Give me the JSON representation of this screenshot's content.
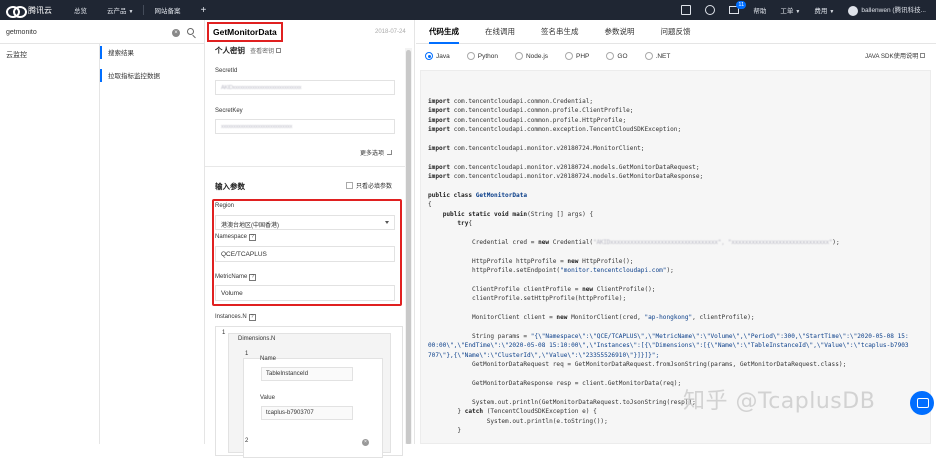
{
  "topbar": {
    "brand": "腾讯云",
    "nav": [
      "总览",
      "云产品",
      "网站备案"
    ],
    "mail_badge": "11",
    "right_items": [
      "帮助",
      "工单",
      "费用"
    ],
    "user": "ballenwen (腾讯科技..."
  },
  "search": {
    "value": "getmonito",
    "placeholder": ""
  },
  "categories": [
    "云监控"
  ],
  "results": {
    "header": "搜索结果",
    "item": "拉取指标监控数据"
  },
  "api": {
    "name": "GetMonitorData",
    "date": "2018-07-24",
    "personal_key_title": "个人密钥",
    "view_key_link": "查看密钥",
    "secret_id_label": "SecretId",
    "secret_id_value": "AKIDxxxxxxxxxxxxxxxxxxxxxxxxxxxx",
    "secret_key_label": "SecretKey",
    "secret_key_value": "xxxxxxxxxxxxxxxxxxxxxxxxxxxxx",
    "more_options": "更多选项",
    "input_params_title": "输入参数",
    "required_only": "只看必填参数",
    "region_label": "Region",
    "region_value": "港澳台地区(中国香港)",
    "namespace_label": "Namespace",
    "namespace_value": "QCE/TCAPLUS",
    "metric_label": "MetricName",
    "metric_value": "Volume",
    "instances_label": "Instances.N",
    "inst_index": "1",
    "dimensions_label": "Dimensions.N",
    "dim_index_1": "1",
    "dim_index_2": "2",
    "name_label": "Name",
    "name_value": "TableInstanceId",
    "value_label": "Value",
    "value_value": "tcaplus-b7903707"
  },
  "tabs": [
    "代码生成",
    "在线调用",
    "签名串生成",
    "参数说明",
    "问题反馈"
  ],
  "languages": [
    {
      "name": "Java",
      "selected": true
    },
    {
      "name": "Python",
      "selected": false
    },
    {
      "name": "Node.js",
      "selected": false
    },
    {
      "name": "PHP",
      "selected": false
    },
    {
      "name": "GO",
      "selected": false
    },
    {
      "name": ".NET",
      "selected": false
    }
  ],
  "sdk_doc_link": "JAVA SDK使用说明",
  "code": {
    "imports_1": [
      "com.tencentcloudapi.common.Credential;",
      "com.tencentcloudapi.common.profile.ClientProfile;",
      "com.tencentcloudapi.common.profile.HttpProfile;",
      "com.tencentcloudapi.common.exception.TencentCloudSDKException;"
    ],
    "imports_2": [
      "com.tencentcloudapi.monitor.v20180724.MonitorClient;"
    ],
    "imports_3": [
      "com.tencentcloudapi.monitor.v20180724.models.GetMonitorDataRequest;",
      "com.tencentcloudapi.monitor.v20180724.models.GetMonitorDataResponse;"
    ],
    "class_name": "GetMonitorData",
    "endpoint": "\"monitor.tencentcloudapi.com\"",
    "region": "\"ap-hongkong\"",
    "params_line1": "\"{\\\"Namespace\\\":\\\"QCE/TCAPLUS\\\",\\\"MetricName\\\":\\\"Volume\\\",\\\"Period\\\":300,\\\"StartTime\\\":\\\"2020-05-08 15:",
    "params_line2": "00:00\\\",\\\"EndTime\\\":\\\"2020-05-08 15:10:00\\\",\\\"Instances\\\":[{\\\"Dimensions\\\":[{\\\"Name\\\":\\\"TableInstanceId\\\",\\\"Value\\\":\\\"tcaplus-b7903",
    "params_line3": "707\\\"},{\\\"Name\\\":\\\"ClusterId\\\",\\\"Value\\\":\\\"23355526910\\\"}]}]}\";"
  },
  "watermark": "知乎 @TcaplusDB"
}
